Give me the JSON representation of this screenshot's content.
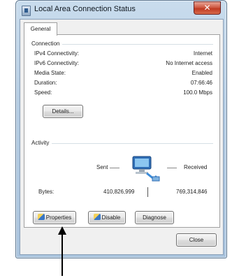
{
  "window": {
    "title": "Local Area Connection Status",
    "close_glyph": "✕"
  },
  "tabs": [
    {
      "label": "General"
    }
  ],
  "connection": {
    "group_label": "Connection",
    "rows": [
      {
        "label": "IPv4 Connectivity:",
        "value": "Internet"
      },
      {
        "label": "IPv6 Connectivity:",
        "value": "No Internet access"
      },
      {
        "label": "Media State:",
        "value": "Enabled"
      },
      {
        "label": "Duration:",
        "value": "07:66:46"
      },
      {
        "label": "Speed:",
        "value": "100.0 Mbps"
      }
    ],
    "details_button": "Details..."
  },
  "activity": {
    "group_label": "Activity",
    "sent_label": "Sent",
    "received_label": "Received",
    "bytes_label": "Bytes:",
    "bytes_sent": "410,826,999",
    "bytes_received": "769,314,846"
  },
  "actions": {
    "properties": "Properties",
    "disable": "Disable",
    "diagnose": "Diagnose"
  },
  "footer": {
    "close_button": "Close"
  },
  "colors": {
    "titlebar": "#b3cbe2",
    "close": "#c7452b",
    "panel": "#f0f0f0"
  },
  "icons": {
    "window": "network-icon",
    "activity": "computer-network-icon",
    "shield": "shield-icon"
  }
}
